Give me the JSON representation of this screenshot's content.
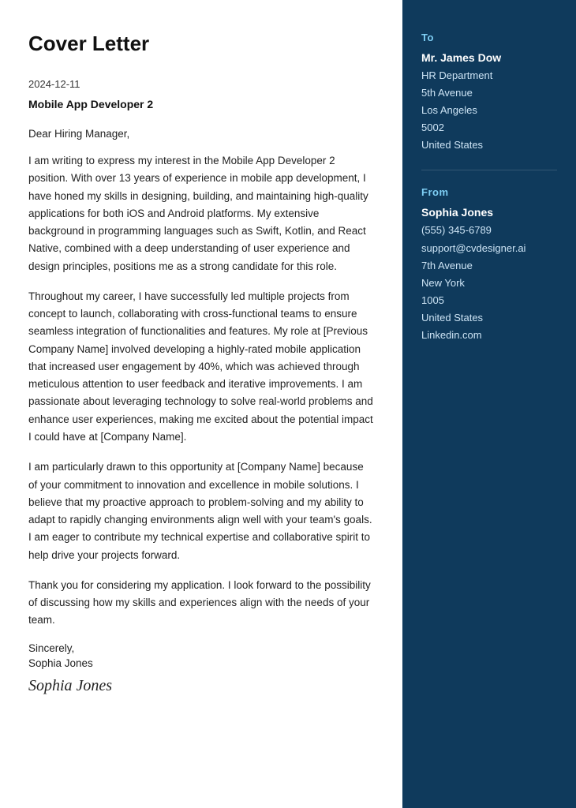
{
  "header": {
    "title": "Cover Letter"
  },
  "letter": {
    "date": "2024-12-11",
    "job_title": "Mobile App Developer 2",
    "salutation": "Dear Hiring Manager,",
    "paragraphs": [
      "I am writing to express my interest in the Mobile App Developer 2 position. With over 13 years of experience in mobile app development, I have honed my skills in designing, building, and maintaining high-quality applications for both iOS and Android platforms. My extensive background in programming languages such as Swift, Kotlin, and React Native, combined with a deep understanding of user experience and design principles, positions me as a strong candidate for this role.",
      "Throughout my career, I have successfully led multiple projects from concept to launch, collaborating with cross-functional teams to ensure seamless integration of functionalities and features. My role at [Previous Company Name] involved developing a highly-rated mobile application that increased user engagement by 40%, which was achieved through meticulous attention to user feedback and iterative improvements. I am passionate about leveraging technology to solve real-world problems and enhance user experiences, making me excited about the potential impact I could have at [Company Name].",
      "I am particularly drawn to this opportunity at [Company Name] because of your commitment to innovation and excellence in mobile solutions. I believe that my proactive approach to problem-solving and my ability to adapt to rapidly changing environments align well with your team's goals. I am eager to contribute my technical expertise and collaborative spirit to help drive your projects forward.",
      "Thank you for considering my application. I look forward to the possibility of discussing how my skills and experiences align with the needs of your team."
    ],
    "closing": "Sincerely,",
    "author_name": "Sophia Jones",
    "signature": "Sophia Jones"
  },
  "sidebar": {
    "to_label": "To",
    "recipient": {
      "name": "Mr. James Dow",
      "department": "HR Department",
      "street": "5th Avenue",
      "city": "Los Angeles",
      "zip": "5002",
      "country": "United States"
    },
    "from_label": "From",
    "sender": {
      "name": "Sophia Jones",
      "phone": "(555) 345-6789",
      "email": "support@cvdesigner.ai",
      "street": "7th Avenue",
      "city": "New York",
      "zip": "1005",
      "country": "United States",
      "website": "Linkedin.com"
    }
  }
}
